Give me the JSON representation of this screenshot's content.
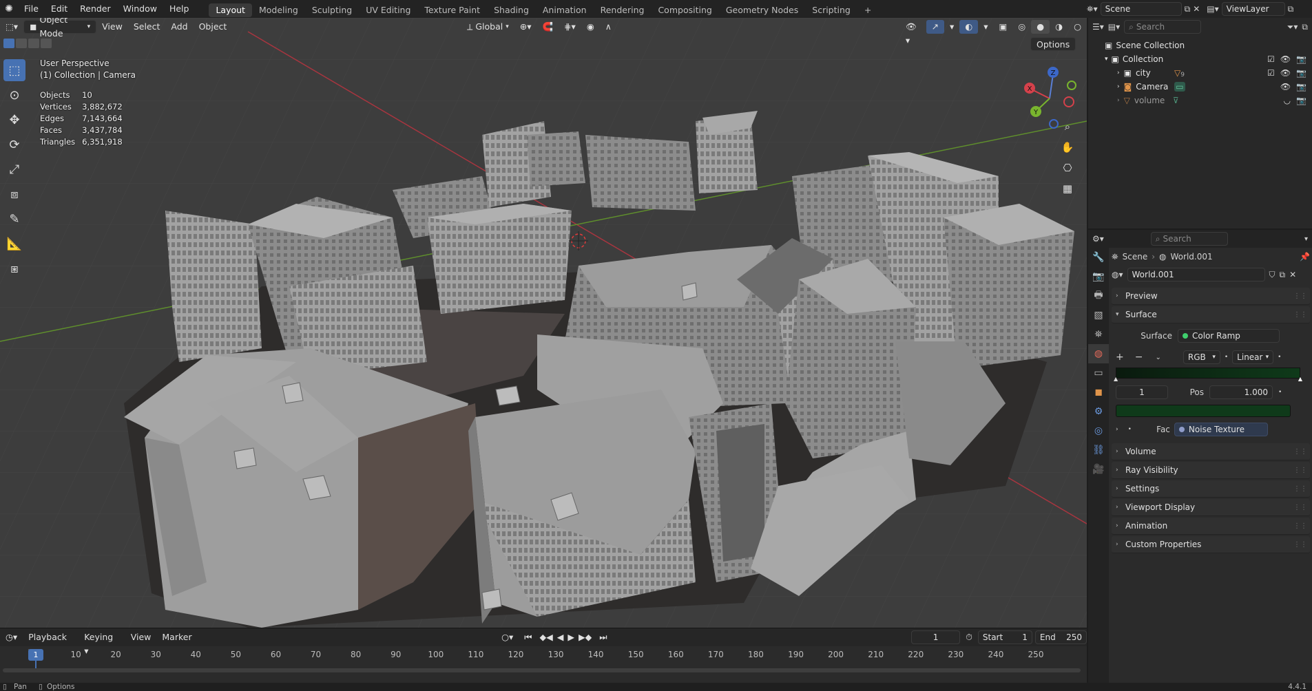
{
  "topbar": {
    "menus": [
      "File",
      "Edit",
      "Render",
      "Window",
      "Help"
    ],
    "workspaces": [
      "Layout",
      "Modeling",
      "Sculpting",
      "UV Editing",
      "Texture Paint",
      "Shading",
      "Animation",
      "Rendering",
      "Compositing",
      "Geometry Nodes",
      "Scripting"
    ],
    "active_workspace": "Layout",
    "add_tab": "+",
    "scene": "Scene",
    "view_layer": "ViewLayer"
  },
  "viewport": {
    "mode": "Object Mode",
    "menus": [
      "View",
      "Select",
      "Add",
      "Object"
    ],
    "transform_orientation": "Global",
    "options_label": "Options",
    "overlay": {
      "perspective": "User Perspective",
      "collection": "(1) Collection | Camera"
    },
    "stats": [
      {
        "label": "Objects",
        "value": "10"
      },
      {
        "label": "Vertices",
        "value": "3,882,672"
      },
      {
        "label": "Edges",
        "value": "7,143,664"
      },
      {
        "label": "Faces",
        "value": "3,437,784"
      },
      {
        "label": "Triangles",
        "value": "6,351,918"
      }
    ],
    "gizmo": {
      "x": "X",
      "y": "Y",
      "z": "Z"
    }
  },
  "timeline": {
    "menus": [
      "Playback",
      "Keying",
      "View",
      "Marker"
    ],
    "current_frame": "1",
    "start_label": "Start",
    "start": "1",
    "end_label": "End",
    "end": "250",
    "ticks": [
      "10",
      "20",
      "30",
      "40",
      "50",
      "60",
      "70",
      "80",
      "90",
      "100",
      "110",
      "120",
      "130",
      "140",
      "150",
      "160",
      "170",
      "180",
      "190",
      "200",
      "210",
      "220",
      "230",
      "240",
      "250"
    ],
    "playhead": "1"
  },
  "outliner": {
    "search_placeholder": "Search",
    "scene_collection": "Scene Collection",
    "collection": "Collection",
    "items": [
      {
        "name": "city",
        "badge": "9"
      },
      {
        "name": "Camera"
      },
      {
        "name": "volume"
      }
    ]
  },
  "properties": {
    "search_placeholder": "Search",
    "breadcrumb_scene": "Scene",
    "breadcrumb_world": "World.001",
    "world_name": "World.001",
    "panels": {
      "preview": "Preview",
      "surface": "Surface",
      "volume": "Volume",
      "ray_visibility": "Ray Visibility",
      "settings": "Settings",
      "viewport_display": "Viewport Display",
      "animation": "Animation",
      "custom_properties": "Custom Properties"
    },
    "surface_label": "Surface",
    "surface_value": "Color Ramp",
    "ramp_mode": "RGB",
    "ramp_interp": "Linear",
    "ramp_index": "1",
    "pos_label": "Pos",
    "pos_value": "1.000",
    "fac_label": "Fac",
    "fac_value": "Noise Texture",
    "ramp_color": "#0f3a1a"
  },
  "statusbar": {
    "pan": "Pan",
    "options": "Options",
    "version": "4.4.1"
  }
}
